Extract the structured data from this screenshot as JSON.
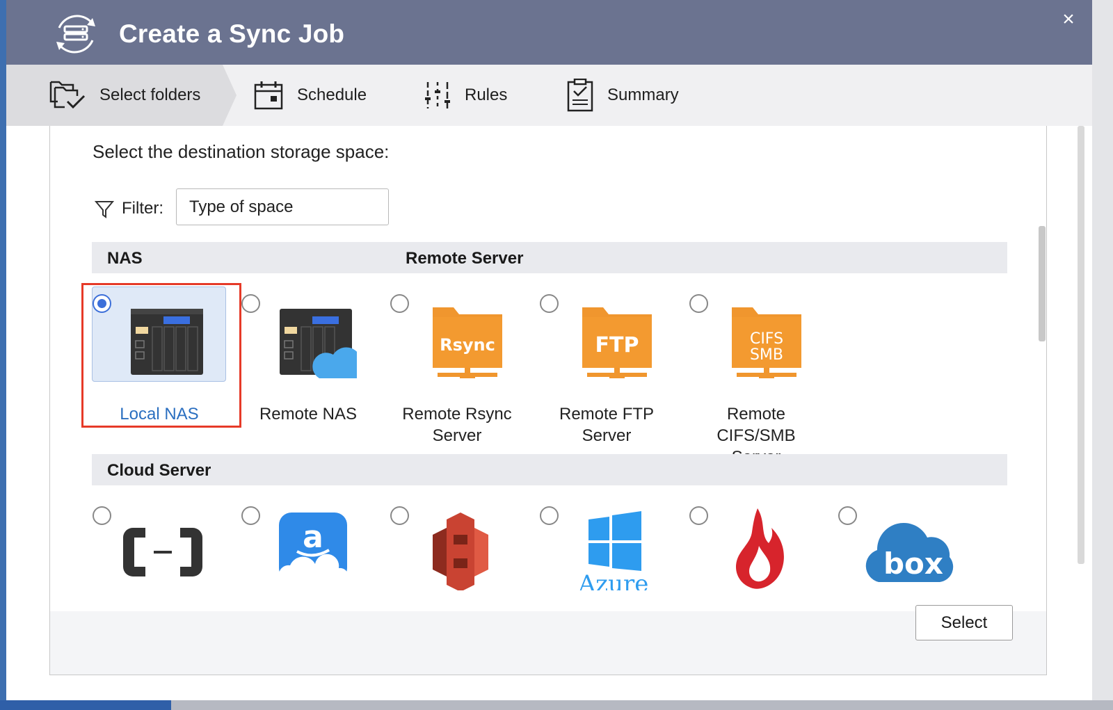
{
  "window": {
    "title": "Create a Sync Job",
    "close_glyph": "×"
  },
  "steps": [
    {
      "label": "Select folders",
      "icon": "folders-check-icon",
      "active": true
    },
    {
      "label": "Schedule",
      "icon": "calendar-icon",
      "active": false
    },
    {
      "label": "Rules",
      "icon": "sliders-icon",
      "active": false
    },
    {
      "label": "Summary",
      "icon": "clipboard-check-icon",
      "active": false
    }
  ],
  "content": {
    "heading": "Select the destination storage space:",
    "filter": {
      "label": "Filter:",
      "value": "Type of space"
    }
  },
  "groups": {
    "nas": "NAS",
    "remote": "Remote Server",
    "cloud": "Cloud Server"
  },
  "nas_tiles": [
    {
      "label": "Local NAS",
      "selected": true,
      "icon": "nas-device-icon"
    },
    {
      "label": "Remote NAS",
      "selected": false,
      "icon": "nas-cloud-icon"
    }
  ],
  "remote_tiles": [
    {
      "label_1": "Remote Rsync",
      "label_2": "Server",
      "badge": "Rsync",
      "icon": "rsync-folder-icon"
    },
    {
      "label_1": "Remote FTP",
      "label_2": "Server",
      "badge": "FTP",
      "icon": "ftp-folder-icon"
    },
    {
      "label_1": "Remote",
      "label_2": "CIFS/SMB",
      "label_3": "Server",
      "badge_1": "CIFS",
      "badge_2": "SMB",
      "icon": "cifs-smb-folder-icon"
    }
  ],
  "cloud_tiles": [
    {
      "icon": "alibaba-cloud-icon"
    },
    {
      "icon": "amazon-drive-icon",
      "glyph": "a"
    },
    {
      "icon": "amazon-s3-icon"
    },
    {
      "icon": "azure-icon",
      "text": "Azure"
    },
    {
      "icon": "backblaze-icon"
    },
    {
      "icon": "box-icon",
      "text": "box"
    }
  ],
  "footer": {
    "select_label": "Select"
  },
  "colors": {
    "titlebar": "#6b7390",
    "accent": "#3c6fd9",
    "highlight": "#e63a28",
    "folder_orange": "#f0962e",
    "link_blue": "#2b6fc0"
  }
}
